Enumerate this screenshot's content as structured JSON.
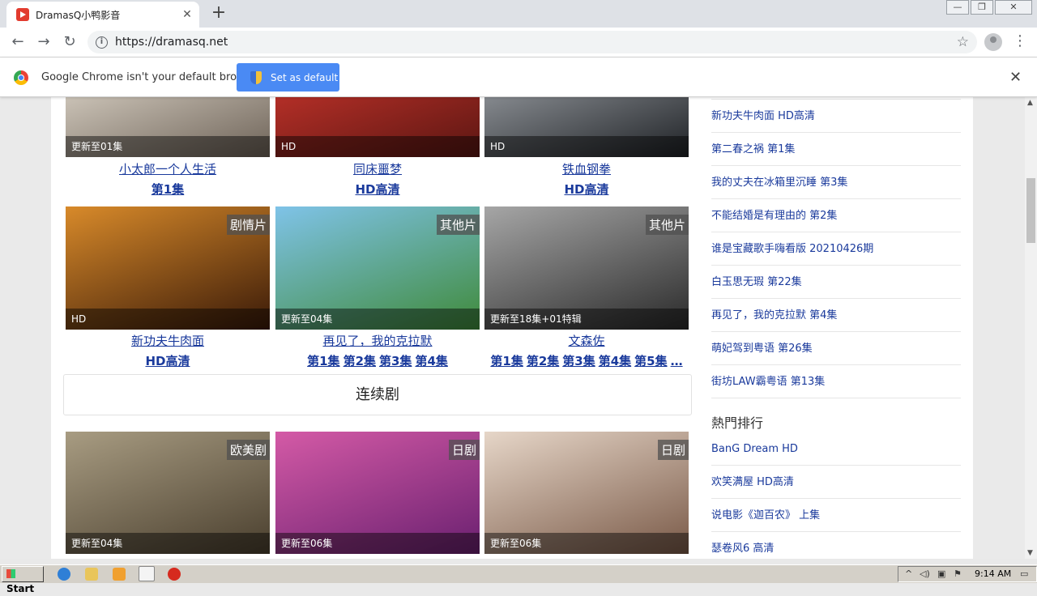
{
  "browser": {
    "tab_title": "DramasQ小鸭影音",
    "tab_close": "✕",
    "new_tab": "+",
    "window_controls": [
      "—",
      "❐",
      "✕"
    ],
    "nav": {
      "back": "←",
      "forward": "→",
      "reload": "↻"
    },
    "url": "https://dramasq.net",
    "star": "☆",
    "menu": "⋮"
  },
  "infobar": {
    "message": "Google Chrome isn't your default browser",
    "button_label": "Set as default",
    "close": "✕"
  },
  "row1": [
    {
      "status": "更新至01集",
      "title": "小太郎一个人生活",
      "episodes": [
        "第1集"
      ],
      "colors": [
        "#cfc7bb",
        "#6e6358"
      ]
    },
    {
      "status": "HD",
      "title": "同床噩梦",
      "episodes": [
        "HD高清"
      ],
      "colors": [
        "#b83028",
        "#5b1612"
      ]
    },
    {
      "status": "HD",
      "title": "铁血钢拳",
      "episodes": [
        "HD高清"
      ],
      "colors": [
        "#8b8f94",
        "#1f2226"
      ]
    }
  ],
  "row2": [
    {
      "category": "剧情片",
      "status": "HD",
      "title": "新功夫牛肉面",
      "episodes": [
        "HD高清"
      ],
      "colors": [
        "#d88a2a",
        "#3a1a08"
      ]
    },
    {
      "category": "其他片",
      "status": "更新至04集",
      "title": "再见了，我的克拉默",
      "episodes": [
        "第1集",
        "第2集",
        "第3集",
        "第4集"
      ],
      "colors": [
        "#7fc3e8",
        "#3f8a3a"
      ]
    },
    {
      "category": "其他片",
      "status": "更新至18集+01特辑",
      "title": "文森佐",
      "episodes": [
        "第1集",
        "第2集",
        "第3集",
        "第4集",
        "第5集",
        "…"
      ],
      "colors": [
        "#a6a6a6",
        "#2a2a2a"
      ]
    }
  ],
  "section_title": "连续剧",
  "row3": [
    {
      "category": "欧美剧",
      "status": "更新至04集",
      "colors": [
        "#a89c82",
        "#4a3f2e"
      ]
    },
    {
      "category": "日剧",
      "status": "更新至06集",
      "colors": [
        "#d45aa6",
        "#6a2070"
      ]
    },
    {
      "category": "日剧",
      "status": "更新至06集",
      "colors": [
        "#e6d6c8",
        "#7a5a48"
      ]
    }
  ],
  "sidebar": {
    "latest": [
      "新功夫牛肉面 HD高清",
      "第二春之祸  第1集",
      "我的丈夫在冰箱里沉睡  第3集",
      "不能结婚是有理由的  第2集",
      "谁是宝藏歌手嗨看版 20210426期",
      "白玉思无瑕  第22集",
      "再见了，我的克拉默 第4集",
      "萌妃驾到粤语  第26集",
      "街坊LAW霸粤语  第13集"
    ],
    "hot_title": "熱門排行",
    "hot": [
      "BanG Dream HD",
      "欢笑满屋 HD高清",
      "说电影《迦百农》 上集",
      "瑟卷风6 高清"
    ]
  },
  "taskbar": {
    "start": "Start",
    "clock": "9:14 AM"
  }
}
